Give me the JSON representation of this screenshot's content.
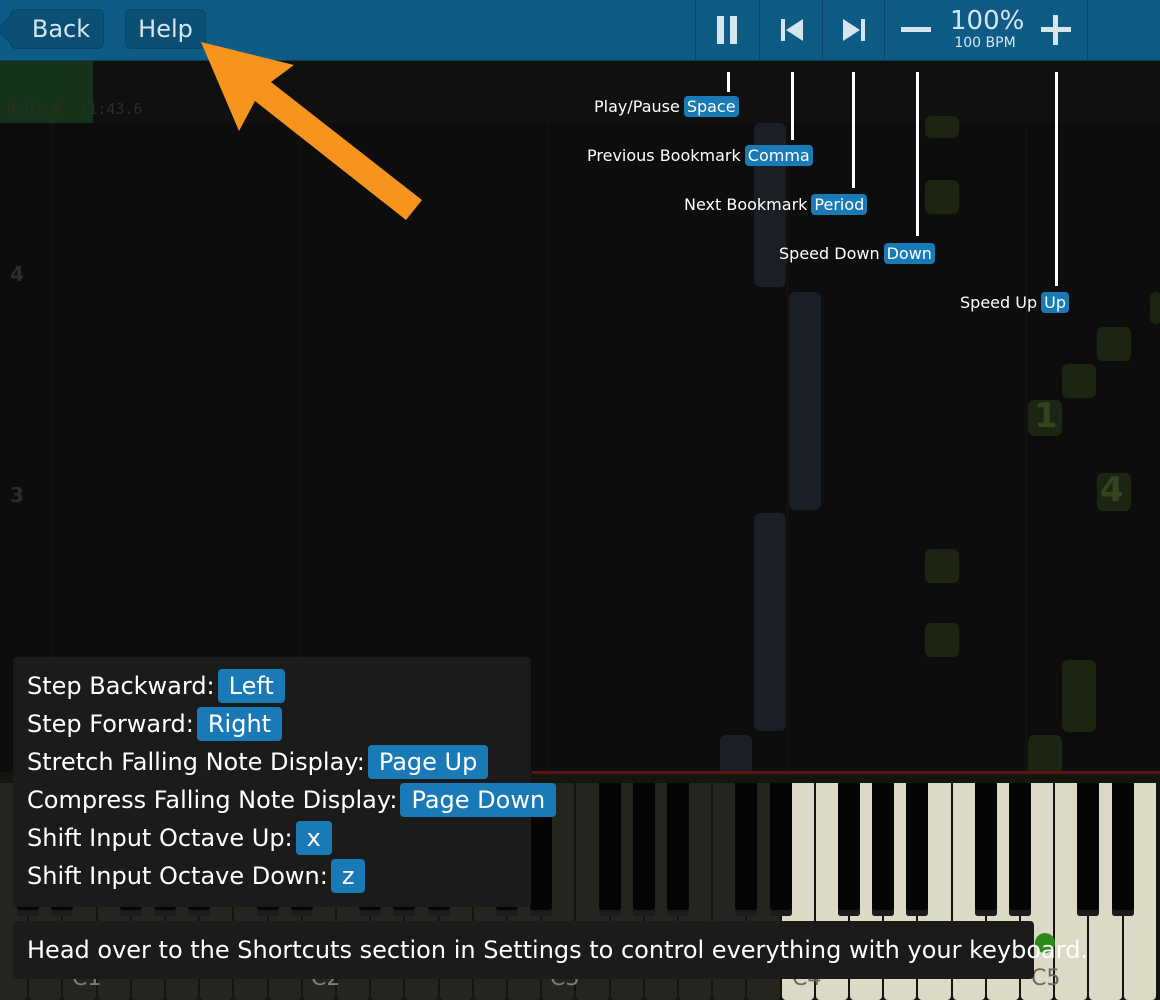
{
  "toolbar": {
    "back_label": "Back",
    "help_label": "Help",
    "speed_percent": "100%",
    "speed_bpm": "100 BPM"
  },
  "playback": {
    "elapsed": "0:01.4",
    "remaining": "+1:43.6"
  },
  "measures": [
    "4",
    "3"
  ],
  "finger_labels": [
    "1",
    "4"
  ],
  "callouts": [
    {
      "label": "Play/Pause",
      "key": "Space"
    },
    {
      "label": "Previous Bookmark",
      "key": "Comma"
    },
    {
      "label": "Next Bookmark",
      "key": "Period"
    },
    {
      "label": "Speed Down",
      "key": "Down"
    },
    {
      "label": "Speed Up",
      "key": "Up"
    }
  ],
  "shortcuts": [
    {
      "label": "Step Backward:",
      "key": "Left"
    },
    {
      "label": "Step Forward:",
      "key": "Right"
    },
    {
      "label": "Stretch Falling Note Display:",
      "key": "Page Up"
    },
    {
      "label": "Compress Falling Note Display:",
      "key": "Page Down"
    },
    {
      "label": "Shift Input Octave Up:",
      "key": "x"
    },
    {
      "label": "Shift Input Octave Down:",
      "key": "z"
    }
  ],
  "footer_tip": "Head over to the Shortcuts section in Settings to control everything with your keyboard.",
  "keyboard": {
    "octave_labels": [
      "C1",
      "C2",
      "C3",
      "C4",
      "C5"
    ]
  },
  "colors": {
    "toolbar": "#0e5c85",
    "key_badge": "#1a7ab5",
    "arrow": "#f7941d",
    "active_white_key": "#dcd9c7"
  },
  "icons": [
    "pause-icon",
    "previous-bookmark-icon",
    "next-bookmark-icon",
    "minus-icon",
    "plus-icon",
    "tutorial-arrow-icon"
  ]
}
